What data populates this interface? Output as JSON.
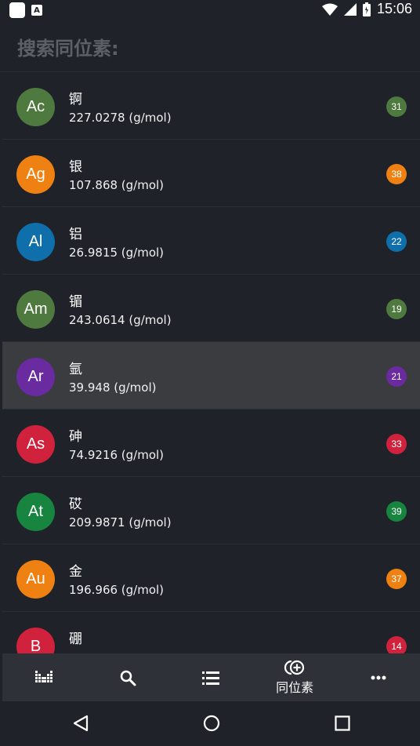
{
  "status_bar": {
    "time": "15:06"
  },
  "search": {
    "title": "搜索同位素:"
  },
  "elements": [
    {
      "symbol": "Ac",
      "name": "锕",
      "mass": "227.0278 (g/mol)",
      "count": "31",
      "color": "#4e7a3f"
    },
    {
      "symbol": "Ag",
      "name": "银",
      "mass": "107.868 (g/mol)",
      "count": "38",
      "color": "#ee8112"
    },
    {
      "symbol": "Al",
      "name": "铝",
      "mass": "26.9815 (g/mol)",
      "count": "22",
      "color": "#0f6fab"
    },
    {
      "symbol": "Am",
      "name": "镅",
      "mass": "243.0614 (g/mol)",
      "count": "19",
      "color": "#4e7a3f"
    },
    {
      "symbol": "Ar",
      "name": "氩",
      "mass": "39.948 (g/mol)",
      "count": "21",
      "color": "#6a2aa0"
    },
    {
      "symbol": "As",
      "name": "砷",
      "mass": "74.9216 (g/mol)",
      "count": "33",
      "color": "#d0223d"
    },
    {
      "symbol": "At",
      "name": "砹",
      "mass": "209.9871 (g/mol)",
      "count": "39",
      "color": "#17843f"
    },
    {
      "symbol": "Au",
      "name": "金",
      "mass": "196.966 (g/mol)",
      "count": "37",
      "color": "#ee8112"
    },
    {
      "symbol": "B",
      "name": "硼",
      "mass": "",
      "count": "14",
      "color": "#d0223d"
    }
  ],
  "bottom_nav": {
    "items": [
      {
        "icon": "periodic-table-icon",
        "label": ""
      },
      {
        "icon": "search-icon",
        "label": ""
      },
      {
        "icon": "list-icon",
        "label": ""
      },
      {
        "icon": "isotope-icon",
        "label": "同位素"
      },
      {
        "icon": "more-icon",
        "label": ""
      }
    ]
  }
}
